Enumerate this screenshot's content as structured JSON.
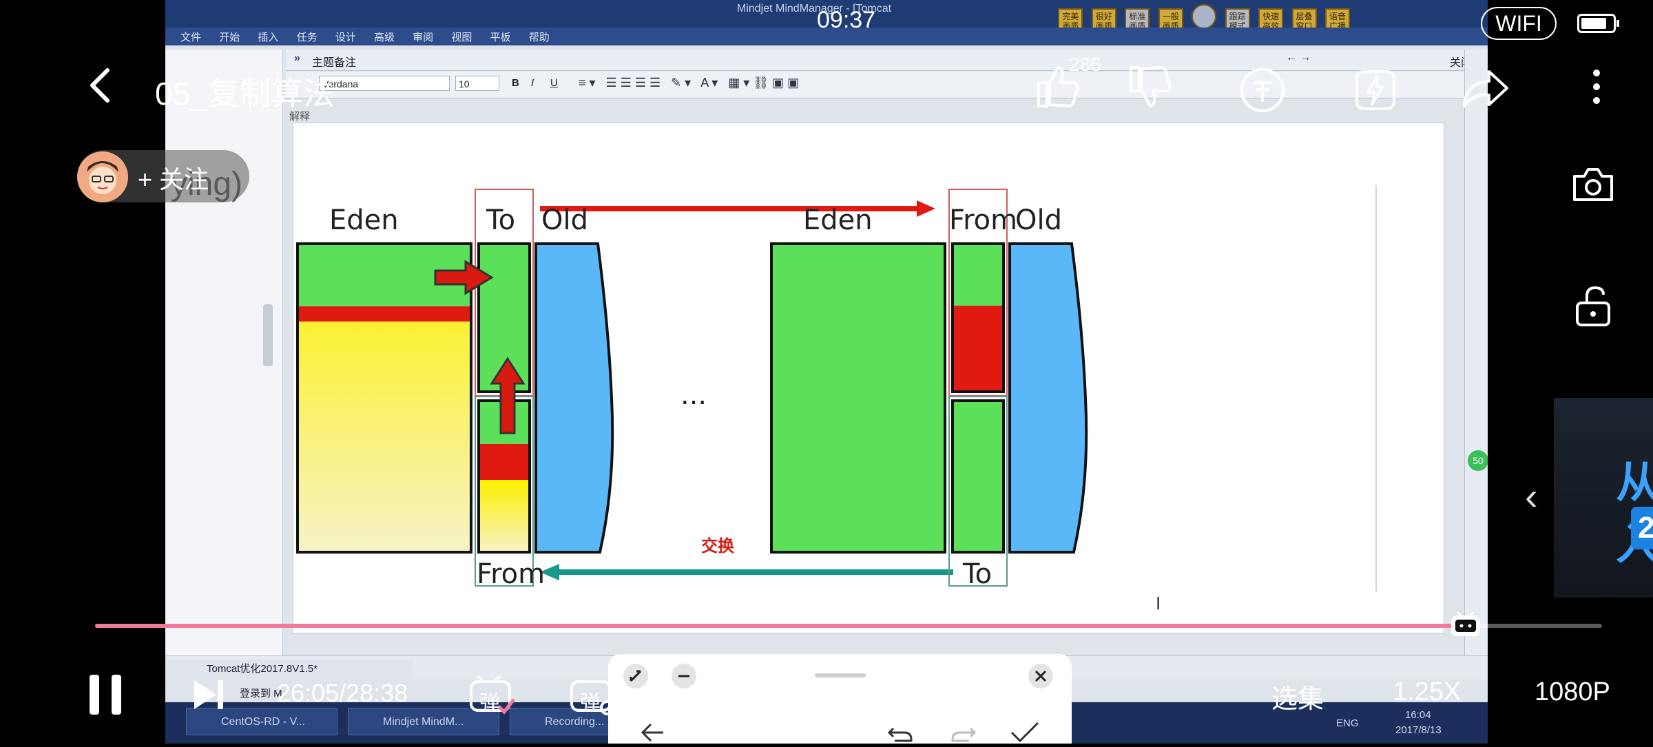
{
  "video": {
    "app_window_title": "Mindjet MindManager - [Tomcat",
    "menu": [
      "文件",
      "开始",
      "插入",
      "任务",
      "设计",
      "高级",
      "审阅",
      "视图",
      "平板",
      "帮助"
    ],
    "ribbon_buttons": [
      "完美画质",
      "很好画质",
      "标准画质",
      "一般画质",
      "",
      "跟踪模式",
      "快速高效",
      "层叠窗口",
      "语音广播"
    ],
    "notes_header": "主题备注",
    "notes_close": "关闭",
    "font_name": "Verdana",
    "font_size": "10",
    "format_buttons": [
      "B",
      "I",
      "U"
    ],
    "explain_label": "解释",
    "diagram": {
      "left": {
        "eden": "Eden",
        "to_top": "To",
        "old": "Old",
        "from_bottom": "From"
      },
      "right": {
        "eden": "Eden",
        "from_top": "From",
        "old": "Old",
        "to_bottom": "To"
      },
      "ellipsis": "...",
      "swap_label": "交换"
    },
    "doc_tab": "Tomcat优化2017.8V1.5*",
    "doc_tab2": "登录到 M",
    "taskbar_items": [
      "CentOS-RD - V...",
      "Mindjet MindM...",
      "Recording..."
    ],
    "tray_lang": "ENG",
    "tray_time": "16:04",
    "tray_date": "2017/8/13",
    "badge_50": "50"
  },
  "status_bar": {
    "time": "09:37",
    "wifi": "WIFI",
    "battery_level": 0.82
  },
  "player": {
    "title": "05_复制算法",
    "follow": "+ 关注",
    "behind_text": "ying)",
    "like_count": "286",
    "progress": 0.917,
    "time_current": "26:05/28:38",
    "danmaku_label": "弹",
    "episodes": "选集",
    "speed": "1.25X",
    "quality": "1080P",
    "side_card_text": "从入",
    "side_card_num": "2"
  },
  "colors": {
    "eden_green": "#5ce05a",
    "red": "#e01a10",
    "yellow": "#fdf000",
    "old_blue": "#5ab8f8",
    "teal": "#16988a",
    "progress_pink": "#f07b9a"
  }
}
